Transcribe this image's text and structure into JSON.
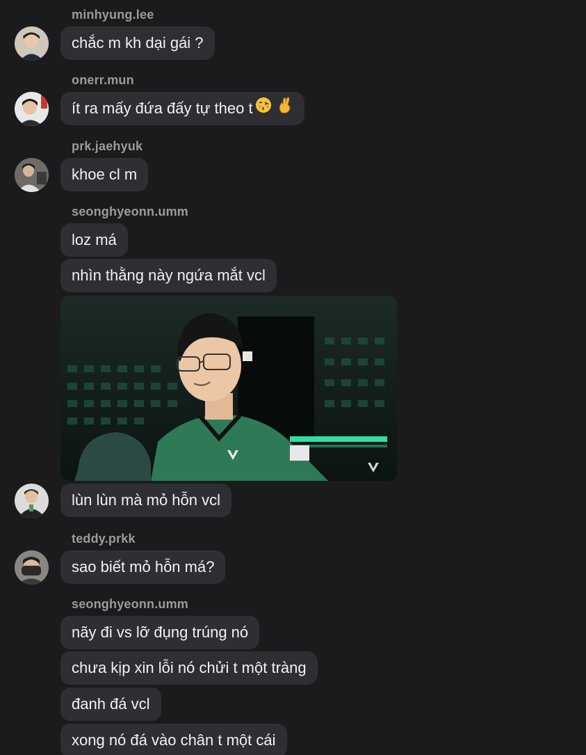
{
  "messages": [
    {
      "sender": "minhyung.lee",
      "avatar": "avatar-person-icon",
      "bubbles": [
        "chắc m kh dại gái ?"
      ]
    },
    {
      "sender": "onerr.mun",
      "avatar": "avatar-person-icon",
      "bubbles": [
        "ít ra mấy đứa đấy tự theo t"
      ]
    },
    {
      "sender": "prk.jaehyuk",
      "avatar": "avatar-person-icon",
      "bubbles": [
        "khoe cl m"
      ]
    },
    {
      "sender": "seonghyeonn.umm",
      "avatar": "avatar-person-icon",
      "bubbles": [
        "loz má",
        "nhìn thằng này ngứa mắt vcl",
        "lùn lùn mà mỏ hỗn vcl"
      ],
      "has_photo": true
    },
    {
      "sender": "teddy.prkk",
      "avatar": "avatar-person-icon",
      "bubbles": [
        "sao biết mỏ hỗn má?"
      ]
    },
    {
      "sender": "seonghyeonn.umm",
      "bubbles": [
        "nãy đi vs lỡ đụng trúng nó",
        "chưa kịp xin lỗi nó chửi t một tràng",
        "đanh đá vcl",
        "xong nó đá vào chân t một cái"
      ]
    }
  ],
  "emojis": {
    "kiss": "face-blowing-kiss-icon",
    "hand": "crossed-fingers-icon"
  },
  "colors": {
    "background": "#1b1b1d",
    "bubble": "#2f2f33",
    "sender_text": "#9b9ba0",
    "message_text": "#f2f2f4"
  }
}
